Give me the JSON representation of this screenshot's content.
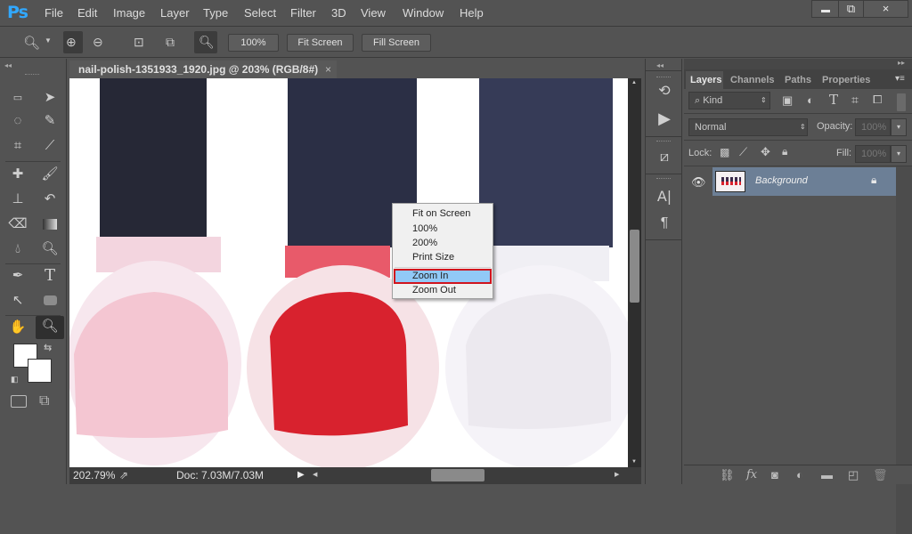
{
  "app": {
    "logo": "Ps",
    "accent": "#31a8ff"
  },
  "menu": [
    "File",
    "Edit",
    "Image",
    "Layer",
    "Type",
    "Select",
    "Filter",
    "3D",
    "View",
    "Window",
    "Help"
  ],
  "window_controls": {
    "minimize": "minimize-icon",
    "restore": "restore-icon",
    "close": "×"
  },
  "options_bar": {
    "tool_icon": "zoom-icon",
    "zoom_in": "zoom-in-icon",
    "zoom_out": "zoom-out-icon",
    "buttons": {
      "hundred": "100%",
      "fit_screen": "Fit Screen",
      "fill_screen": "Fill Screen"
    }
  },
  "document": {
    "tab_title": "nail-polish-1351933_1920.jpg @ 203% (RGB/8#)",
    "close": "×"
  },
  "status": {
    "zoom": "202.79%",
    "doc": "Doc: 7.03M/7.03M"
  },
  "context_menu": {
    "items": [
      "Fit on Screen",
      "100%",
      "200%",
      "Print Size",
      "Zoom In",
      "Zoom Out"
    ],
    "highlighted": "Zoom In"
  },
  "tools": [
    "marquee",
    "move",
    "lasso",
    "quick-selection",
    "crop",
    "eyedropper",
    "healing-brush",
    "brush",
    "clone-stamp",
    "history-brush",
    "eraser",
    "gradient",
    "blur",
    "dodge",
    "pen",
    "type",
    "path-selection",
    "rectangle",
    "hand",
    "zoom"
  ],
  "panels": {
    "tabs": [
      "Layers",
      "Channels",
      "Paths",
      "Properties"
    ],
    "active_tab": "Layers",
    "filter_kind": "Kind",
    "blend_mode": "Normal",
    "opacity_label": "Opacity:",
    "opacity_value": "100%",
    "lock_label": "Lock:",
    "fill_label": "Fill:",
    "fill_value": "100%",
    "layers": [
      {
        "name": "Background",
        "visible": true,
        "locked": true,
        "selected": true
      }
    ]
  },
  "colors": {
    "foreground": "#ffffff",
    "background": "#ffffff",
    "selected_layer": "#6c7f96",
    "highlight_border": "#d0141e",
    "highlight_fill": "#91c9f7"
  }
}
